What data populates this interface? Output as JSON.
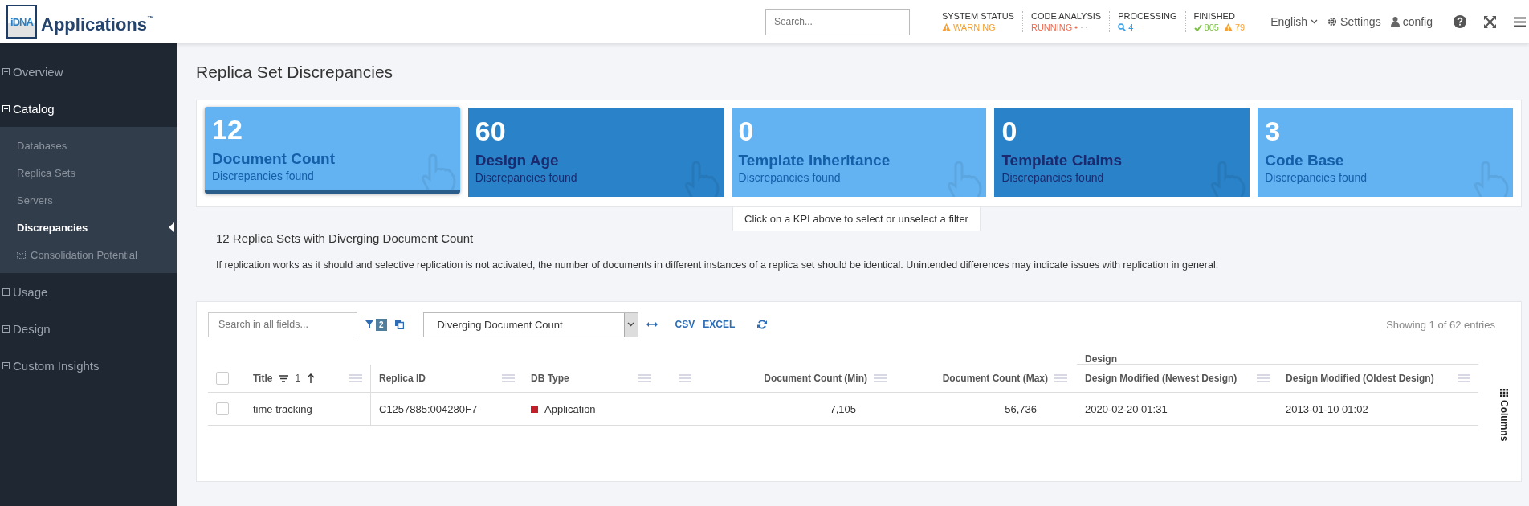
{
  "header": {
    "logo_mark": "iDNA",
    "app_name": "Applications",
    "trademark": "™",
    "search": {
      "placeholder": "Search..."
    },
    "status": [
      {
        "label": "SYSTEM STATUS",
        "values": [
          {
            "kind": "warning",
            "text": "WARNING",
            "color": "#f5a031"
          }
        ]
      },
      {
        "label": "CODE ANALYSIS",
        "values": [
          {
            "kind": "running",
            "text": "RUNNING",
            "color": "#f26b4f"
          }
        ]
      },
      {
        "label": "PROCESSING",
        "values": [
          {
            "kind": "search",
            "text": "4",
            "color": "#3a9ee4"
          }
        ]
      },
      {
        "label": "FINISHED",
        "values": [
          {
            "kind": "check",
            "text": "805",
            "color": "#7ac143"
          },
          {
            "kind": "warning",
            "text": "79",
            "color": "#f5a031"
          }
        ]
      }
    ],
    "language": "English",
    "settings": "Settings",
    "user": "config"
  },
  "sidebar": {
    "items": [
      {
        "label": "Overview",
        "expanded": false
      },
      {
        "label": "Catalog",
        "expanded": true,
        "children": [
          {
            "label": "Databases",
            "selected": false
          },
          {
            "label": "Replica Sets",
            "selected": false
          },
          {
            "label": "Servers",
            "selected": false
          },
          {
            "label": "Discrepancies",
            "selected": true
          },
          {
            "label": "Consolidation Potential",
            "selected": false,
            "kind": "icon"
          }
        ]
      },
      {
        "label": "Usage",
        "expanded": false
      },
      {
        "label": "Design",
        "expanded": false
      },
      {
        "label": "Custom Insights",
        "expanded": false
      }
    ]
  },
  "page": {
    "title": "Replica Set Discrepancies"
  },
  "kpis": [
    {
      "value": "12",
      "title": "Document Count",
      "subtitle": "Discrepancies found",
      "color": "#63b3f3",
      "selected": true
    },
    {
      "value": "60",
      "title": "Design Age",
      "subtitle": "Discrepancies found",
      "color": "#2a83c9",
      "selected": false
    },
    {
      "value": "0",
      "title": "Template Inheritance",
      "subtitle": "Discrepancies found",
      "color": "#63b3f3",
      "selected": false
    },
    {
      "value": "0",
      "title": "Template Claims",
      "subtitle": "Discrepancies found",
      "color": "#2a83c9",
      "selected": false
    },
    {
      "value": "3",
      "title": "Code Base",
      "subtitle": "Discrepancies found",
      "color": "#63b3f3",
      "selected": false
    }
  ],
  "kpi_hint": "Click on a KPI above to select or unselect a filter",
  "summary": {
    "heading": "12 Replica Sets with Diverging Document Count",
    "text": "If replication works as it should and selective replication is not activated, the number of documents in different instances of a replica set should be identical. Unintended differences may indicate issues with replication in general."
  },
  "table": {
    "search": {
      "placeholder": "Search in all fields..."
    },
    "filter_count": "2",
    "view_select": "Diverging Document Count",
    "export": [
      "CSV",
      "EXCEL"
    ],
    "entries": "Showing 1 of 62 entries",
    "column_group": "Design",
    "sort_order": "1",
    "columns_button": "Columns",
    "columns": [
      {
        "kind": "title",
        "label": "Title"
      },
      {
        "kind": "text",
        "label": "Replica ID"
      },
      {
        "kind": "text",
        "label": "DB Type"
      },
      {
        "kind": "blank"
      },
      {
        "kind": "number",
        "label": "Document Count (Min)"
      },
      {
        "kind": "number",
        "label": "Document Count (Max)"
      },
      {
        "kind": "text",
        "label": "Design Modified (Newest Design)"
      },
      {
        "kind": "text",
        "label": "Design Modified (Oldest Design)"
      }
    ],
    "select_all": {
      "checked": false
    },
    "rows": [
      {
        "selected": false,
        "cells": [
          {
            "text": "time tracking"
          },
          {
            "text": "C1257885:004280F7"
          },
          {
            "text": "Application",
            "color": "#c0202a"
          },
          {
            "text": ""
          },
          {
            "text": "7,105"
          },
          {
            "text": "56,736"
          },
          {
            "text": "2020-02-20 01:31"
          },
          {
            "text": "2013-01-10 01:02"
          }
        ]
      }
    ]
  }
}
